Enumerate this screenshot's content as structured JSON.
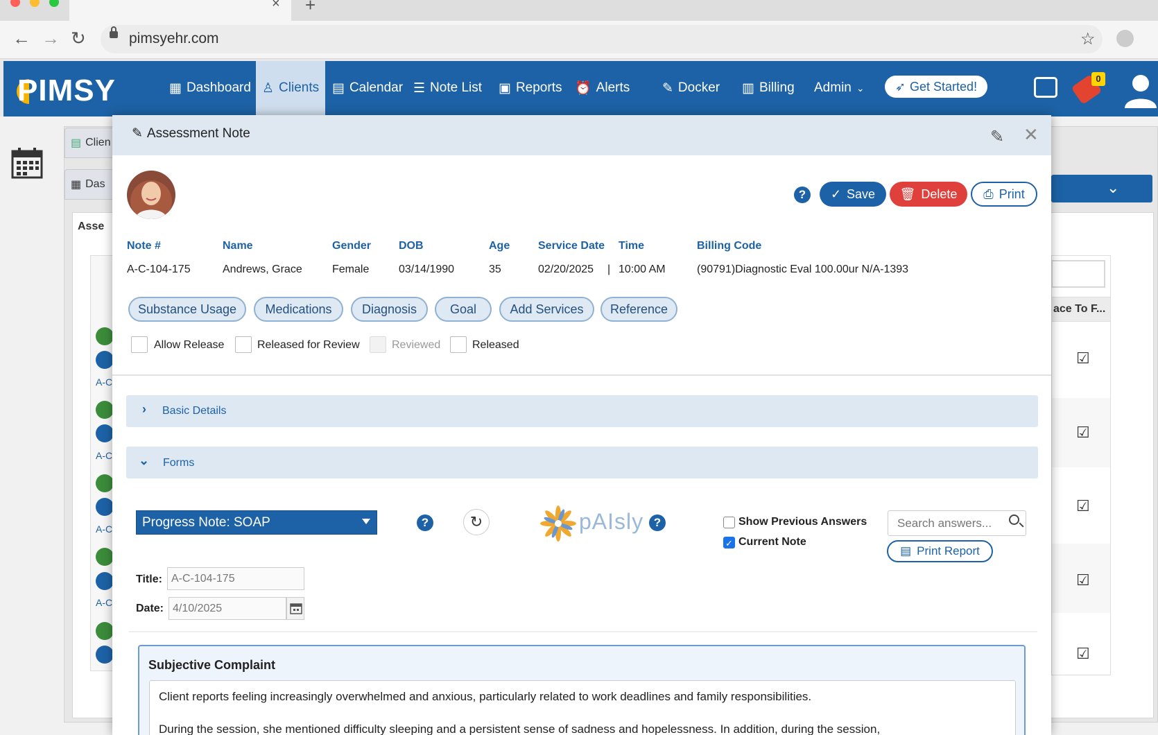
{
  "browser": {
    "url": "pimsyehr.com"
  },
  "app": {
    "logo": "PIMSY",
    "nav": [
      {
        "label": "Dashboard",
        "icon": "dashboard-icon"
      },
      {
        "label": "Clients",
        "icon": "user-icon"
      },
      {
        "label": "Calendar",
        "icon": "calendar-icon"
      },
      {
        "label": "Note List",
        "icon": "list-icon"
      },
      {
        "label": "Reports",
        "icon": "report-icon"
      },
      {
        "label": "Alerts",
        "icon": "alarm-icon"
      },
      {
        "label": "Docker",
        "icon": "pin-icon"
      },
      {
        "label": "Billing",
        "icon": "billing-icon"
      },
      {
        "label": "Admin",
        "icon": "chevron-down-icon"
      }
    ],
    "get_started": "Get Started!",
    "notification_count": "0",
    "accent": "#1d62a6"
  },
  "background": {
    "tabs": [
      "Clien",
      "Das"
    ],
    "inner_tab": "Asse",
    "row_labels": [
      "A-C",
      "A-C",
      "A-C",
      "A-C"
    ],
    "right_header": "ace To F..."
  },
  "modal": {
    "title": "Assessment Note",
    "save": "Save",
    "delete": "Delete",
    "print": "Print",
    "help": "?",
    "info": {
      "labels": [
        "Note #",
        "Name",
        "Gender",
        "DOB",
        "Age",
        "Service Date",
        "Time",
        "Billing Code"
      ],
      "note_no": "A-C-104-175",
      "name": "Andrews, Grace",
      "gender": "Female",
      "dob": "03/14/1990",
      "age": "35",
      "service_date": "02/20/2025",
      "separator": "|",
      "time": "10:00 AM",
      "billing_code": "(90791)Diagnostic Eval 100.00ur N/A-1393"
    },
    "pills": [
      "Substance Usage",
      "Medications",
      "Diagnosis",
      "Goal",
      "Add Services",
      "Reference"
    ],
    "checkboxes": [
      "Allow Release",
      "Released for Review",
      "Reviewed",
      "Released"
    ],
    "sections": {
      "basic_details": "Basic Details",
      "forms": "Forms"
    },
    "form": {
      "selected": "Progress Note: SOAP",
      "paisly": "pAIsly",
      "show_previous": "Show Previous Answers",
      "current_note": "Current Note",
      "search_placeholder": "Search answers...",
      "print_report": "Print Report",
      "title_label": "Title:",
      "title_value": "A-C-104-175",
      "date_label": "Date:",
      "date_value": "4/10/2025"
    },
    "subjective": {
      "title": "Subjective Complaint",
      "p1": "Client reports feeling increasingly overwhelmed and anxious, particularly related to work deadlines and family responsibilities.",
      "p2": "During the session, she mentioned difficulty sleeping and a persistent sense of sadness and hopelessness. In addition, during the session,"
    }
  }
}
